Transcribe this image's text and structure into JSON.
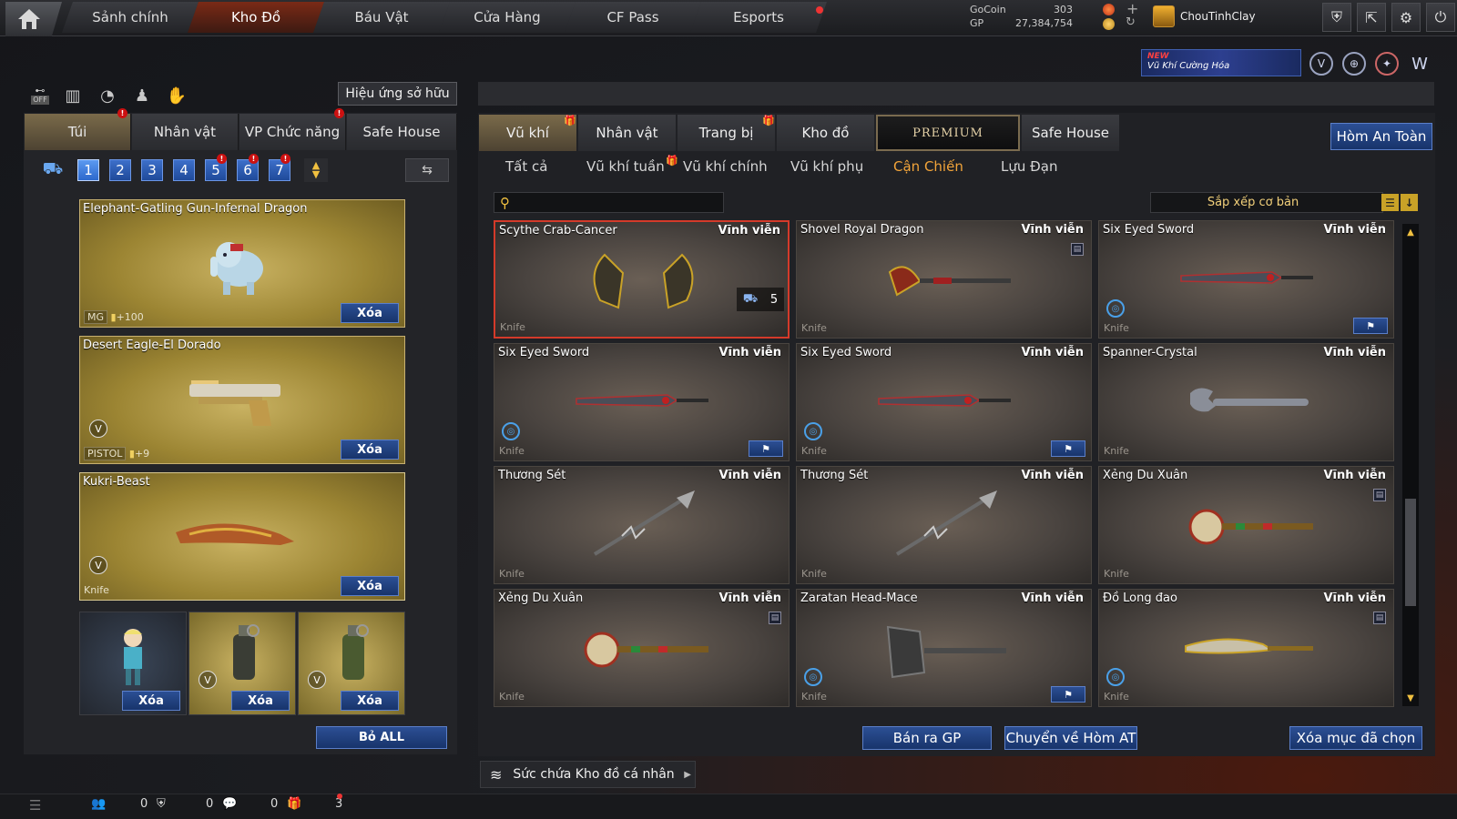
{
  "nav": {
    "tabs": [
      "Sảnh chính",
      "Kho Đồ",
      "Báu Vật",
      "Cửa Hàng",
      "CF Pass",
      "Esports"
    ]
  },
  "currency": {
    "gocoin_label": "GoCoin",
    "gocoin_value": "303",
    "gp_label": "GP",
    "gp_value": "27,384,754"
  },
  "user": {
    "name": "ChouTinhClay"
  },
  "banner": {
    "new": "NEW",
    "text": "Vũ Khí Cường Hóa"
  },
  "left": {
    "own_effect_btn": "Hiệu ứng sở hữu",
    "tabs": [
      "Túi",
      "Nhân vật",
      "VP Chức năng",
      "Safe House"
    ],
    "slots": [
      "1",
      "2",
      "3",
      "4",
      "5",
      "6",
      "7"
    ],
    "equipped": [
      {
        "name": "Elephant-Gatling Gun-Infernal Dragon",
        "category": "MG",
        "bonus": "+100",
        "delete": "Xóa"
      },
      {
        "name": "Desert Eagle-El Dorado",
        "category": "PISTOL",
        "bonus": "+9",
        "delete": "Xóa"
      },
      {
        "name": "Kukri-Beast",
        "category": "Knife",
        "delete": "Xóa"
      }
    ],
    "small_slots": [
      {
        "delete": "Xóa"
      },
      {
        "delete": "Xóa"
      },
      {
        "delete": "Xóa"
      }
    ],
    "remove_all": "Bỏ ALL"
  },
  "right": {
    "tabs": [
      "Vũ khí",
      "Nhân vật",
      "Trang bị",
      "Kho đồ",
      "PREMIUM",
      "Safe House"
    ],
    "safe_box_btn": "Hòm An Toàn",
    "subtabs": [
      "Tất cả",
      "Vũ khí tuần",
      "Vũ khí chính",
      "Vũ khí phụ",
      "Cận Chiến",
      "Lựu Đạn"
    ],
    "search_placeholder": "",
    "sort_label": "Sắp xếp cơ bản",
    "items": [
      {
        "name": "Scythe Crab-Cancer",
        "term": "Vĩnh viễn",
        "category": "Knife",
        "stack": "5"
      },
      {
        "name": "Shovel Royal Dragon",
        "term": "Vĩnh viễn",
        "category": "Knife"
      },
      {
        "name": "Six Eyed Sword",
        "term": "Vĩnh viễn",
        "category": "Knife"
      },
      {
        "name": "Six Eyed Sword",
        "term": "Vĩnh viễn",
        "category": "Knife"
      },
      {
        "name": "Six Eyed Sword",
        "term": "Vĩnh viễn",
        "category": "Knife"
      },
      {
        "name": "Spanner-Crystal",
        "term": "Vĩnh viễn",
        "category": "Knife"
      },
      {
        "name": "Thương Sét",
        "term": "Vĩnh viễn",
        "category": "Knife"
      },
      {
        "name": "Thương Sét",
        "term": "Vĩnh viễn",
        "category": "Knife"
      },
      {
        "name": "Xẻng Du Xuân",
        "term": "Vĩnh viễn",
        "category": "Knife"
      },
      {
        "name": "Xẻng Du Xuân",
        "term": "Vĩnh viễn",
        "category": "Knife"
      },
      {
        "name": "Zaratan Head-Mace",
        "term": "Vĩnh viễn",
        "category": "Knife"
      },
      {
        "name": "Đồ Long đao",
        "term": "Vĩnh viễn",
        "category": "Knife"
      }
    ],
    "actions": {
      "sell": "Bán ra GP",
      "move": "Chuyển về Hòm AT",
      "delete_selected": "Xóa mục đã chọn"
    },
    "capacity": "Sức chứa Kho đồ cá nhân"
  },
  "bottom": {
    "count_1": "0",
    "count_2": "0",
    "count_3": "0",
    "count_4": "3"
  },
  "colors": {
    "accent_blue": "#2c4f94",
    "active_subtab": "#f2a43a",
    "selected_border": "#d43a2a",
    "equipped_gold": "#9c8533"
  }
}
